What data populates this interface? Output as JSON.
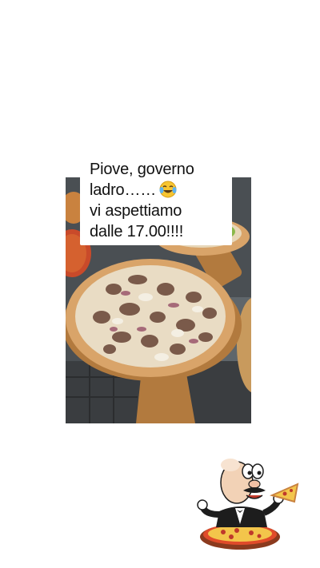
{
  "post": {
    "caption_lines": [
      "Piove, governo",
      "ladro……",
      "vi aspettiamo",
      "dalle 17.00!!!!"
    ],
    "emoji": "laughing-crying-emoji"
  },
  "colors": {
    "background": "#ffffff",
    "caption_text": "#111111",
    "pizza_crust": "#d9a469",
    "wood_peel": "#b27a3e"
  },
  "icons": {
    "mascot": "pizza-chef-mascot-icon",
    "emoji": "laughing-crying-emoji-icon"
  }
}
